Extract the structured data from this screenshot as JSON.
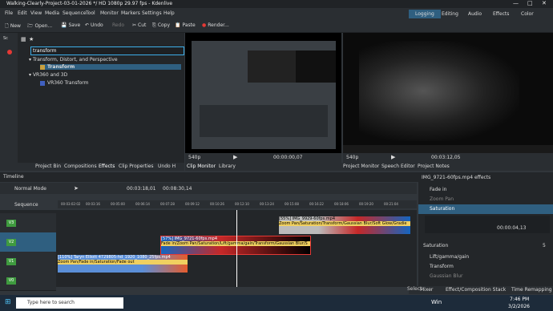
{
  "window": {
    "title": "Walking-Clearly-Project-03-01-2026 */ HD 1080p 29.97 fps - Kdenlive"
  },
  "menu": [
    "File",
    "Edit",
    "View",
    "Media",
    "Sequence",
    "Tool",
    "Monitor",
    "Markers",
    "Settings",
    "Help"
  ],
  "workspaces": [
    "Logging",
    "Editing",
    "Audio",
    "Effects",
    "Color"
  ],
  "toolbar": {
    "new": "New",
    "open": "Open...",
    "save": "Save",
    "undo": "Undo",
    "redo": "Redo",
    "cut": "Cut",
    "copy": "Copy",
    "paste": "Paste",
    "render": "Render..."
  },
  "effects": {
    "search": "transform",
    "cat1": "Transform, Distort, and Perspective",
    "item1": "Transform",
    "cat2": "VR360 and 3D",
    "item2": "VR360 Transform"
  },
  "leftTabs": [
    "Project Bin",
    "Compositions",
    "Effects",
    "Clip Properties",
    "Undo H"
  ],
  "monitors": {
    "clip_zoom": "540p",
    "clip_tc": "00:00:00,07",
    "clip_dur": "00:03:12,05",
    "proj_zoom": "540p",
    "proj_tc": "00:03:12,05"
  },
  "rightTabs": [
    "Clip Monitor",
    "Library",
    "Project Monitor",
    "Speech Editor",
    "Project Notes"
  ],
  "timeline": {
    "label": "Timeline",
    "mode": "Normal Mode",
    "tc": "00:03:18,01",
    "dur": "00:08:30,14",
    "sequence": "Sequence"
  },
  "ruler": [
    "00:03:02:02",
    "00:03:16",
    "00:05:00",
    "00:06:14",
    "00:07:28",
    "00:09:12",
    "00:10:26",
    "00:12:10",
    "00:13:24",
    "00:15:08",
    "00:16:22",
    "00:18:06",
    "00:19:20",
    "00:21:04"
  ],
  "tracks": [
    "V3",
    "V2",
    "V1",
    "V0"
  ],
  "clips": [
    {
      "title": "[55%] IMG_9929-60fps.mp4",
      "fx": "Zoom Pan/Saturation/Transform/Gaussian Blur/Soft Glow/Gradie"
    },
    {
      "title": "[57%] IMG_9721-60fps.mp4",
      "fx": "Fade in/Zoom Pan/Saturation/Lift/gamma/gain/Transform/Gaussian Blur/S"
    },
    {
      "title": "[110%] Taryn Elliott 4729805-hd_1920_1080_25fps.mp4",
      "fx": "Zoom Pan/Fade in/Saturation/Fade out"
    }
  ],
  "effectStack": {
    "title": "IMG_9721-60fps.mp4 effects",
    "rows": [
      "Fade in",
      "Zoom Pan",
      "Saturation",
      "Lift/gamma/gain",
      "Transform",
      "Gaussian Blur"
    ],
    "param": "Saturation",
    "paramVal": "5",
    "tc": "00:00:04,13"
  },
  "bottomTabs": [
    "Mixer",
    "Effect/Composition Stack",
    "Time Remapping"
  ],
  "taskbar": {
    "search": "Type here to search",
    "time": "7:46 PM",
    "date": "3/2/2026",
    "weather": "Win",
    "select": "Select"
  }
}
